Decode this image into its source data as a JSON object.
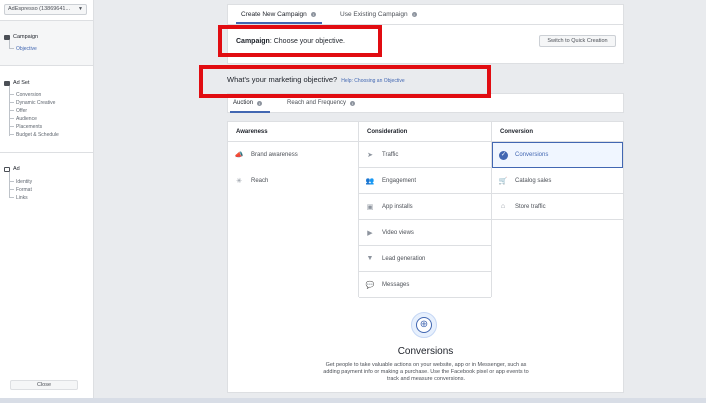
{
  "sidebar": {
    "account_selector": "AdEspresso (13869641...",
    "campaign": {
      "label": "Campaign",
      "sub": "Objective"
    },
    "adset": {
      "label": "Ad Set",
      "items": [
        "Conversion",
        "Dynamic Creative",
        "Offer",
        "Audience",
        "Placements",
        "Budget & Schedule"
      ]
    },
    "ad": {
      "label": "Ad",
      "items": [
        "Identity",
        "Format",
        "Links"
      ]
    },
    "close_label": "Close"
  },
  "header_tabs": [
    {
      "label": "Create New Campaign",
      "active": true
    },
    {
      "label": "Use Existing Campaign",
      "active": false
    }
  ],
  "campaign_line": {
    "label": "Campaign",
    "text": ": Choose your objective."
  },
  "quick_creation_label": "Switch to Quick Creation",
  "objective_title": "What's your marketing objective?",
  "help_link": "Help: Choosing an Objective",
  "buying_tabs": [
    {
      "label": "Auction",
      "active": true
    },
    {
      "label": "Reach and Frequency",
      "active": false
    }
  ],
  "columns": [
    {
      "title": "Awareness",
      "options": [
        {
          "label": "Brand awareness",
          "icon": "megaphone-icon"
        },
        {
          "label": "Reach",
          "icon": "reach-icon"
        }
      ]
    },
    {
      "title": "Consideration",
      "options": [
        {
          "label": "Traffic",
          "icon": "cursor-icon"
        },
        {
          "label": "Engagement",
          "icon": "engagement-icon"
        },
        {
          "label": "App installs",
          "icon": "box-icon"
        },
        {
          "label": "Video views",
          "icon": "video-icon"
        },
        {
          "label": "Lead generation",
          "icon": "funnel-icon"
        },
        {
          "label": "Messages",
          "icon": "chat-icon"
        }
      ]
    },
    {
      "title": "Conversion",
      "options": [
        {
          "label": "Conversions",
          "icon": "check-icon",
          "selected": true
        },
        {
          "label": "Catalog sales",
          "icon": "cart-icon"
        },
        {
          "label": "Store traffic",
          "icon": "store-icon"
        }
      ]
    }
  ],
  "detail": {
    "title": "Conversions",
    "description": "Get people to take valuable actions on your website, app or in Messenger, such as adding payment info or making a purchase. Use the Facebook pixel or app events to track and measure conversions."
  },
  "colors": {
    "accent": "#4267b2",
    "highlight": "#e10c11"
  }
}
